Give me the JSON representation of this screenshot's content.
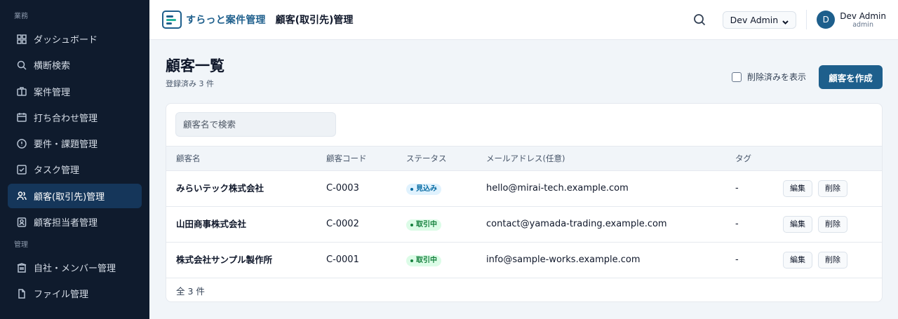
{
  "sidebar": {
    "section1": "業務",
    "section2": "管理",
    "items": [
      {
        "label": "ダッシュボード",
        "icon": "dashboard-icon"
      },
      {
        "label": "横断検索",
        "icon": "search-icon"
      },
      {
        "label": "案件管理",
        "icon": "briefcase-icon"
      },
      {
        "label": "打ち合わせ管理",
        "icon": "calendar-icon"
      },
      {
        "label": "要件・課題管理",
        "icon": "alert-circle-icon"
      },
      {
        "label": "タスク管理",
        "icon": "checkbox-icon"
      },
      {
        "label": "顧客(取引先)管理",
        "icon": "users-icon"
      },
      {
        "label": "顧客担当者管理",
        "icon": "contact-icon"
      },
      {
        "label": "自社・メンバー管理",
        "icon": "building-icon"
      },
      {
        "label": "ファイル管理",
        "icon": "file-icon"
      }
    ]
  },
  "header": {
    "logo_text": "すらっと案件管理",
    "page_title": "顧客(取引先)管理",
    "user_select": "Dev Admin",
    "avatar_initial": "D",
    "user_name": "Dev Admin",
    "user_role": "admin"
  },
  "main": {
    "title": "顧客一覧",
    "subtitle": "登録済み 3 件",
    "show_deleted_label": "削除済みを表示",
    "create_button": "顧客を作成",
    "search_placeholder": "顧客名で検索",
    "columns": [
      "顧客名",
      "顧客コード",
      "ステータス",
      "メールアドレス(任意)",
      "タグ"
    ],
    "rows": [
      {
        "name": "みらいテック株式会社",
        "code": "C-0003",
        "status": "見込み",
        "status_type": "prospect",
        "email": "hello@mirai-tech.example.com",
        "tag": "-"
      },
      {
        "name": "山田商事株式会社",
        "code": "C-0002",
        "status": "取引中",
        "status_type": "active",
        "email": "contact@yamada-trading.example.com",
        "tag": "-"
      },
      {
        "name": "株式会社サンプル製作所",
        "code": "C-0001",
        "status": "取引中",
        "status_type": "active",
        "email": "info@sample-works.example.com",
        "tag": "-"
      }
    ],
    "edit_label": "編集",
    "delete_label": "削除",
    "footer_count": "全 3 件"
  },
  "colors": {
    "sidebar_bg": "#0f1b2d",
    "accent": "#1e5f8c",
    "prospect_badge": "#0369a1",
    "active_badge": "#15803d"
  }
}
